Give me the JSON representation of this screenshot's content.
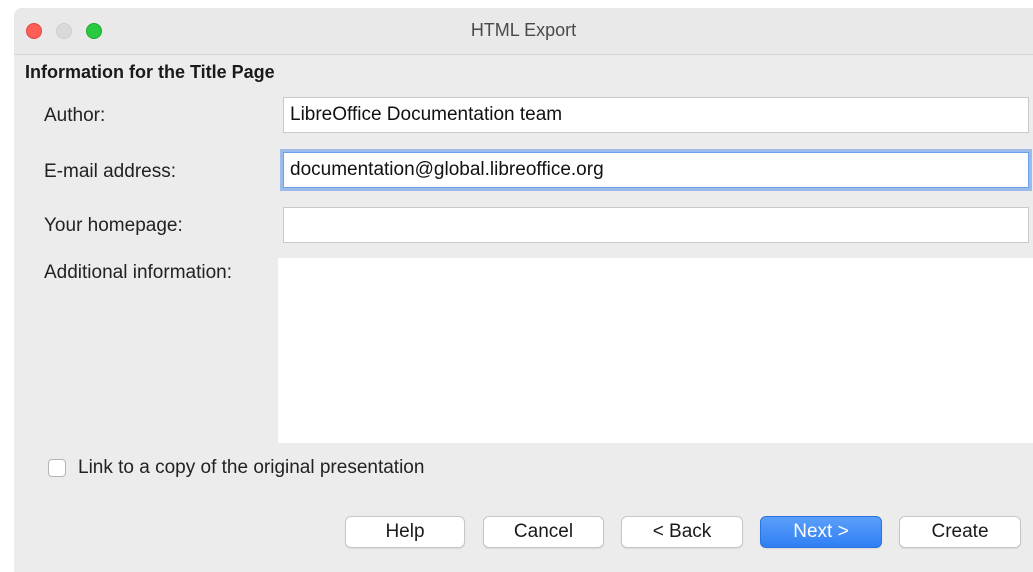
{
  "window": {
    "title": "HTML Export"
  },
  "section": {
    "heading": "Information for the Title Page"
  },
  "form": {
    "author": {
      "label": "Author:",
      "value": "LibreOffice Documentation team"
    },
    "email": {
      "label": "E-mail address:",
      "value": "documentation@global.libreoffice.org"
    },
    "homepage": {
      "label": "Your homepage:",
      "value": ""
    },
    "additional": {
      "label": "Additional information:",
      "value": ""
    },
    "link_checkbox": {
      "label": "Link to a copy of the original presentation",
      "checked": false
    }
  },
  "buttons": {
    "help": "Help",
    "cancel": "Cancel",
    "back": "< Back",
    "next": "Next >",
    "create": "Create"
  },
  "colors": {
    "close": "#fd5f57",
    "minimize_inactive": "#d9d9d9",
    "zoom": "#29c940",
    "primary_button": "#2f7ff5",
    "focus_ring": "#5a96eb"
  },
  "icons": {
    "close": "close-icon",
    "minimize": "minimize-icon",
    "zoom": "zoom-icon"
  }
}
